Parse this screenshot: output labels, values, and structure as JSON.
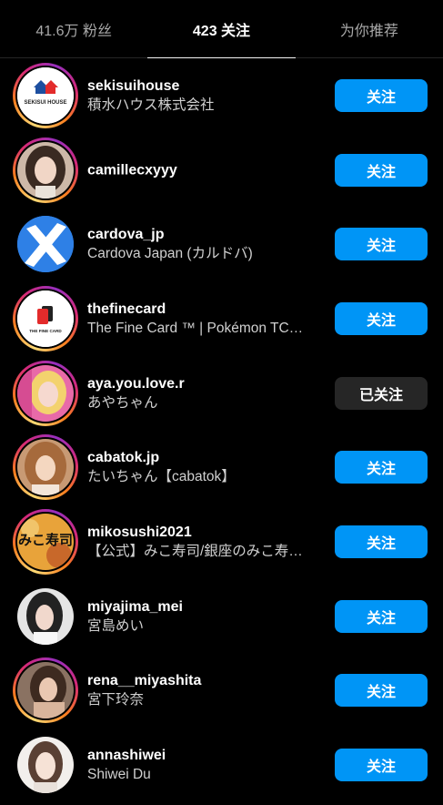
{
  "tabs": {
    "followers": "41.6万 粉丝",
    "following": "423 关注",
    "suggested": "为你推荐"
  },
  "rows": [
    {
      "username": "sekisuihouse",
      "name": "積水ハウス株式会社",
      "button": "关注",
      "logo_text": "SEKISUI HOUSE"
    },
    {
      "username": "camillecxyyy",
      "name": "",
      "button": "关注"
    },
    {
      "username": "cardova_jp",
      "name": "Cardova Japan (カルドバ)",
      "button": "关注"
    },
    {
      "username": "thefinecard",
      "name": "The Fine Card ™ | Pokémon TC…",
      "button": "关注",
      "logo_text": "THE FINE CARD"
    },
    {
      "username": "aya.you.love.r",
      "name": "あやちゃん",
      "button": "已关注"
    },
    {
      "username": "cabatok.jp",
      "name": "たいちゃん【cabatok】",
      "button": "关注"
    },
    {
      "username": "mikosushi2021",
      "name": "【公式】みこ寿司/銀座のみこ寿…",
      "button": "关注",
      "logo_text": "みこ寿司"
    },
    {
      "username": "miyajima_mei",
      "name": "宮島めい",
      "button": "关注"
    },
    {
      "username": "rena__miyashita",
      "name": "宮下玲奈",
      "button": "关注"
    },
    {
      "username": "annashiwei",
      "name": "Shiwei Du",
      "button": "关注"
    }
  ],
  "colors": {
    "background": "#000000",
    "follow_button": "#0095f6",
    "following_button": "#262626"
  }
}
